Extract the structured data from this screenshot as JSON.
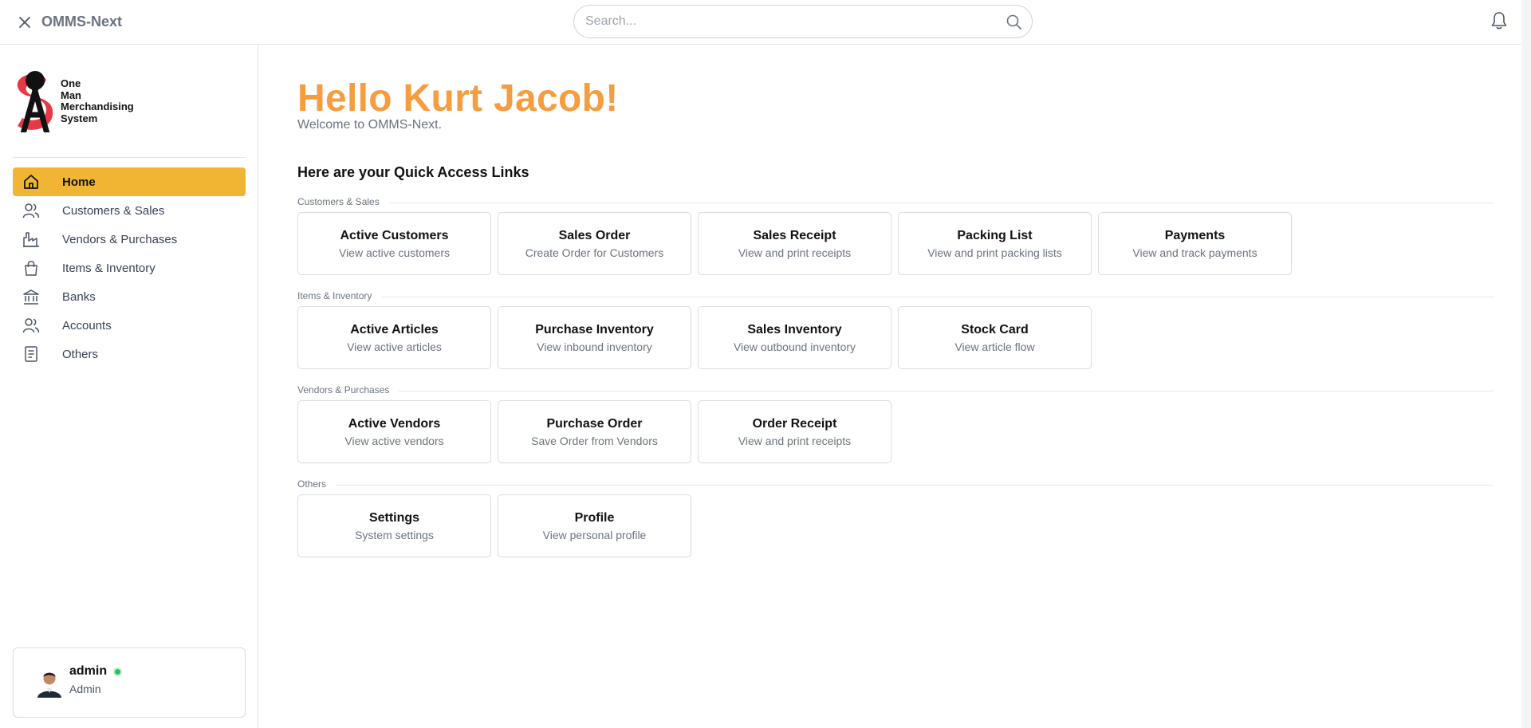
{
  "topbar": {
    "app_title": "OMMS-Next",
    "search_placeholder": "Search..."
  },
  "logo": {
    "lines": [
      "One",
      "Man",
      "Merchandising",
      "System"
    ]
  },
  "sidebar": {
    "items": [
      {
        "label": "Home",
        "icon": "home-icon",
        "active": true
      },
      {
        "label": "Customers & Sales",
        "icon": "users-icon"
      },
      {
        "label": "Vendors & Purchases",
        "icon": "factory-icon"
      },
      {
        "label": "Items & Inventory",
        "icon": "shopping-bag-icon"
      },
      {
        "label": "Banks",
        "icon": "bank-icon"
      },
      {
        "label": "Accounts",
        "icon": "users-icon"
      },
      {
        "label": "Others",
        "icon": "document-icon"
      }
    ]
  },
  "user": {
    "name": "admin",
    "role": "Admin",
    "status_color": "#22c55e"
  },
  "main": {
    "greeting": "Hello Kurt Jacob!",
    "welcome": "Welcome to OMMS-Next.",
    "quick_title": "Here are your Quick Access Links",
    "sections": [
      {
        "label": "Customers & Sales",
        "cards": [
          {
            "title": "Active Customers",
            "desc": "View active customers"
          },
          {
            "title": "Sales Order",
            "desc": "Create Order for Customers"
          },
          {
            "title": "Sales Receipt",
            "desc": "View and print receipts"
          },
          {
            "title": "Packing List",
            "desc": "View and print packing lists"
          },
          {
            "title": "Payments",
            "desc": "View and track payments"
          }
        ]
      },
      {
        "label": "Items & Inventory",
        "cards": [
          {
            "title": "Active Articles",
            "desc": "View active articles"
          },
          {
            "title": "Purchase Inventory",
            "desc": "View inbound inventory"
          },
          {
            "title": "Sales Inventory",
            "desc": "View outbound inventory"
          },
          {
            "title": "Stock Card",
            "desc": "View article flow"
          }
        ]
      },
      {
        "label": "Vendors & Purchases",
        "cards": [
          {
            "title": "Active Vendors",
            "desc": "View active vendors"
          },
          {
            "title": "Purchase Order",
            "desc": "Save Order from Vendors"
          },
          {
            "title": "Order Receipt",
            "desc": "View and print receipts"
          }
        ]
      },
      {
        "label": "Others",
        "cards": [
          {
            "title": "Settings",
            "desc": "System settings"
          },
          {
            "title": "Profile",
            "desc": "View personal profile"
          }
        ]
      }
    ]
  },
  "colors": {
    "accent": "#f0b532",
    "greeting": "#f59d3f",
    "logo_red": "#e63946"
  }
}
